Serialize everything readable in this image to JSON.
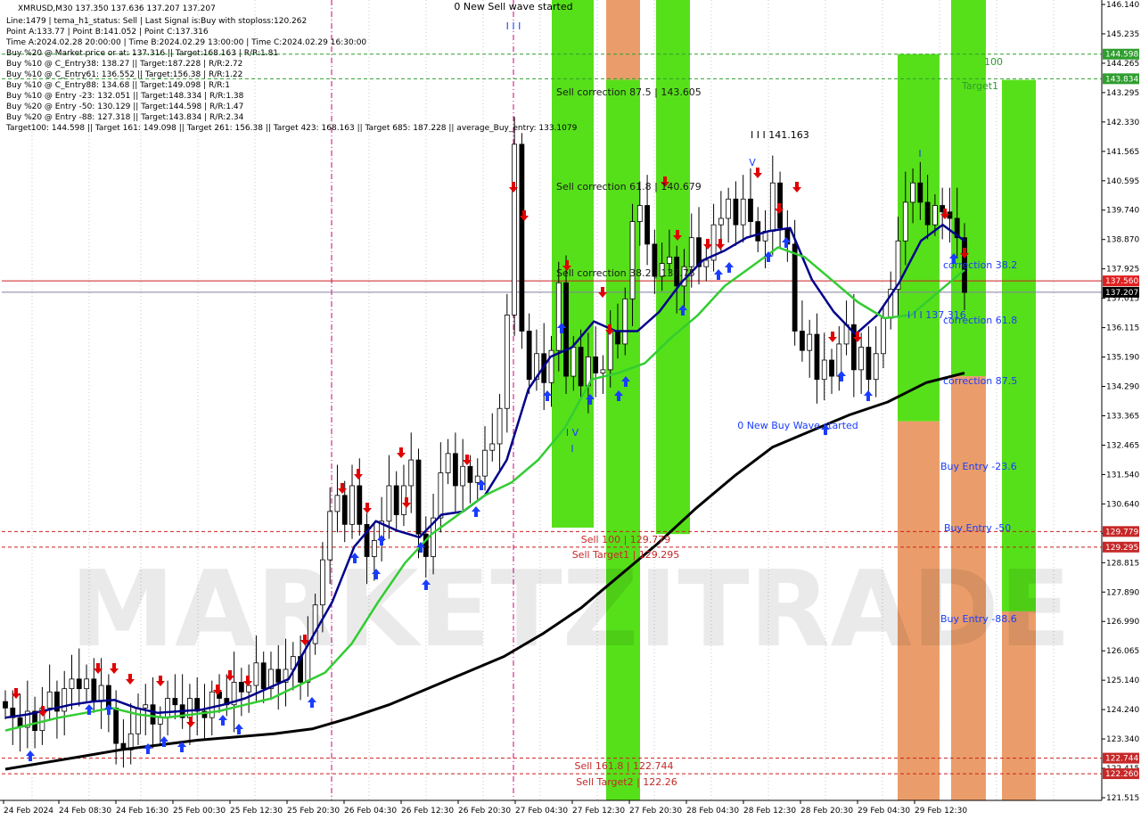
{
  "header": {
    "symbol_line": "XMRUSD,M30  137.350 137.636 137.207 137.207",
    "lines": [
      "Line:1479 | tema_h1_status: Sell | Last Signal is:Buy with stoploss:120.262",
      "Point A:133.77 | Point B:141.052 | Point C:137.316",
      "Time A:2024.02.28 20:00:00 | Time B:2024.02.29 13:00:00 | Time C:2024.02.29 16:30:00",
      "Buy %20 @ Market price or at: 137.316 || Target:168.163 | R/R:1.81",
      "Buy %10 @ C_Entry38: 138.27 || Target:187.228 | R/R:2.72",
      "Buy %10 @ C_Entry61: 136.552 || Target:156.38 | R/R:1.22",
      "Buy %10 @ C_Entry88: 134.68 || Target:149.098 | R/R:1",
      "Buy %10 @ Entry -23: 132.051 || Target:148.334 | R/R:1.38",
      "Buy %20 @ Entry -50: 130.129 || Target:144.598 | R/R:1.47",
      "Buy %20 @ Entry -88: 127.318 || Target:143.834 | R/R:2.34",
      "Target100: 144.598 || Target 161: 149.098 || Target 261: 156.38 || Target 423: 168.163 || Target 685: 187.228 || average_Buy_entry: 133.1079"
    ]
  },
  "watermark": "MARKETZITRADE",
  "price_axis": {
    "ticks": [
      "146.140",
      "145.235",
      "144.265",
      "143.295",
      "142.330",
      "141.565",
      "140.595",
      "139.740",
      "138.870",
      "137.925",
      "137.015",
      "136.115",
      "135.190",
      "134.290",
      "133.365",
      "132.465",
      "131.540",
      "130.640",
      "129.715",
      "128.815",
      "127.890",
      "126.990",
      "126.065",
      "125.140",
      "124.240",
      "123.340",
      "122.415",
      "121.515"
    ],
    "badges": [
      {
        "label": "144.598",
        "price": 144.598,
        "color": "#2e9e2e"
      },
      {
        "label": "143.834",
        "price": 143.834,
        "color": "#2e9e2e"
      },
      {
        "label": "137.560",
        "price": 137.56,
        "color": "#e02020"
      },
      {
        "label": "137.207",
        "price": 137.207,
        "color": "#000000"
      },
      {
        "label": "129.779",
        "price": 129.779,
        "color": "#c62828"
      },
      {
        "label": "129.295",
        "price": 129.295,
        "color": "#c62828"
      },
      {
        "label": "122.744",
        "price": 122.744,
        "color": "#c62828"
      },
      {
        "label": "122.260",
        "price": 122.26,
        "color": "#c62828"
      }
    ]
  },
  "time_axis": {
    "labels": [
      "24 Feb 2024",
      "24 Feb 08:30",
      "24 Feb 16:30",
      "25 Feb 00:30",
      "25 Feb 12:30",
      "25 Feb 20:30",
      "26 Feb 04:30",
      "26 Feb 12:30",
      "26 Feb 20:30",
      "27 Feb 04:30",
      "27 Feb 12:30",
      "27 Feb 20:30",
      "28 Feb 04:30",
      "28 Feb 12:30",
      "28 Feb 20:30",
      "29 Feb 04:30",
      "29 Feb 12:30"
    ]
  },
  "annotations": {
    "new_sell_wave": "0 New Sell wave started",
    "sell_wave_marker": "I I I",
    "sell_corr_875": "Sell correction 87.5 | 143.605",
    "sell_corr_618": "Sell correction 61.8 | 140.679",
    "sell_corr_382": "Sell correction 38.2 | 137.75",
    "sell_100": "Sell 100 | 129.779",
    "sell_target1": "Sell Target1 | 129.295",
    "sell_1618": "Sell 161.8 | 122.744",
    "sell_target2": "Sell Target2 | 122.26",
    "high_label": "I I I 141.163",
    "v_marker": "V",
    "iv_marker": "I V",
    "i_marker": "I",
    "new_buy_wave": "0 New Buy Wave started",
    "c_label": "I I I 137.316",
    "corr_382": "correction 38.2",
    "corr_618": "correction 61.8",
    "corr_875": "correction 87.5",
    "buy_entry_23": "Buy Entry -23.6",
    "buy_entry_50": "Buy Entry -50",
    "buy_entry_88": "Buy Entry -88.6",
    "target_100": "100",
    "target_1": "Target1"
  },
  "colors": {
    "green_zone": "#44dd00",
    "orange_zone": "#e8925a",
    "fast_ma": "#00008b",
    "mid_ma": "#33cc33",
    "slow_ma": "#000000",
    "sell_arrow": "#e00000",
    "buy_arrow": "#1a3cff",
    "level_red": "#c62828"
  },
  "chart_data": {
    "type": "candlestick",
    "symbol": "XMRUSD",
    "timeframe": "M30",
    "ylim": [
      121.1,
      146.3
    ],
    "levels": [
      {
        "price": 144.598,
        "style": "dashed",
        "color": "green"
      },
      {
        "price": 143.834,
        "style": "dashed",
        "color": "green"
      },
      {
        "price": 137.56,
        "style": "solid",
        "color": "red"
      },
      {
        "price": 137.207,
        "style": "solid",
        "color": "gray"
      },
      {
        "price": 129.779,
        "style": "dashed",
        "color": "red"
      },
      {
        "price": 129.295,
        "style": "dashed",
        "color": "red"
      },
      {
        "price": 122.744,
        "style": "dashed",
        "color": "red"
      },
      {
        "price": 122.26,
        "style": "dashed",
        "color": "red"
      }
    ],
    "price_path": [
      124.3,
      124.0,
      123.7,
      124.2,
      123.6,
      124.3,
      124.8,
      124.2,
      124.9,
      125.2,
      124.9,
      125.2,
      124.5,
      125.0,
      124.3,
      123.2,
      123.0,
      123.5,
      124.3,
      124.4,
      123.8,
      124.0,
      124.6,
      124.4,
      124.0,
      124.6,
      124.2,
      124.0,
      124.8,
      124.6,
      124.4,
      125.1,
      124.8,
      125.0,
      125.7,
      124.9,
      125.5,
      125.1,
      125.5,
      125.9,
      125.1,
      126.3,
      127.5,
      128.9,
      130.4,
      130.9,
      130.0,
      131.2,
      130.0,
      129.0,
      129.5,
      130.1,
      131.2,
      130.3,
      131.2,
      132.0,
      129.7,
      129.0,
      130.2,
      131.6,
      132.2,
      131.2,
      131.8,
      131.3,
      131.5,
      132.3,
      132.5,
      133.6,
      136.5,
      141.8,
      136.0,
      134.5,
      135.3,
      134.4,
      135.4,
      137.5,
      134.6,
      135.5,
      134.3,
      135.2,
      134.7,
      134.8,
      136.0,
      135.6,
      137.0,
      139.4,
      139.9,
      138.7,
      137.7,
      138.1,
      138.3,
      137.4,
      138.0,
      138.9,
      138.0,
      138.2,
      139.3,
      139.5,
      140.1,
      139.3,
      140.1,
      139.4,
      138.8,
      139.1,
      140.6,
      139.2,
      138.7,
      136.0,
      135.4,
      135.9,
      134.5,
      135.1,
      134.6,
      135.6,
      136.2,
      134.8,
      135.5,
      134.5,
      135.3,
      136.4,
      137.3,
      138.8,
      140.0,
      140.6,
      140.0,
      139.3,
      139.9,
      139.7,
      139.5,
      138.9,
      137.2
    ],
    "moving_averages": [
      {
        "name": "fast",
        "color": "#00008b",
        "values": [
          124.0,
          124.1,
          124.25,
          124.4,
          124.5,
          124.55,
          124.3,
          124.15,
          124.2,
          124.25,
          124.4,
          124.6,
          124.9,
          125.2,
          126.4,
          127.6,
          129.3,
          130.1,
          129.8,
          129.6,
          130.3,
          130.4,
          130.9,
          132.0,
          134.2,
          135.2,
          135.5,
          136.3,
          136.0,
          136.0,
          136.6,
          137.5,
          138.2,
          138.5,
          138.9,
          139.1,
          139.2,
          137.6,
          136.6,
          135.9,
          136.5,
          137.5,
          138.8,
          139.3,
          138.8
        ]
      },
      {
        "name": "mid",
        "color": "#33cc33",
        "values": [
          123.6,
          123.8,
          124.0,
          124.15,
          124.3,
          124.1,
          124.0,
          124.1,
          124.2,
          124.4,
          124.6,
          125.0,
          125.4,
          126.3,
          127.6,
          128.8,
          129.7,
          130.3,
          130.9,
          131.3,
          132.0,
          133.0,
          134.5,
          134.7,
          135.0,
          135.8,
          136.5,
          137.4,
          138.0,
          138.6,
          138.3,
          137.6,
          136.9,
          136.4,
          136.5,
          137.2,
          137.9
        ]
      },
      {
        "name": "slow",
        "color": "#000000",
        "values": [
          122.4,
          122.6,
          122.8,
          123.0,
          123.15,
          123.3,
          123.4,
          123.5,
          123.65,
          124.0,
          124.4,
          124.9,
          125.4,
          125.9,
          126.6,
          127.4,
          128.4,
          129.4,
          130.5,
          131.5,
          132.4,
          132.9,
          133.4,
          133.8,
          134.4,
          134.7
        ]
      }
    ],
    "zones": [
      {
        "label": "sell green zone 1",
        "from": 146.3,
        "to": 129.9,
        "color": "green"
      },
      {
        "label": "sell orange zone",
        "from": 146.3,
        "to": 143.8,
        "color": "orange"
      },
      {
        "label": "sell green zone 2",
        "from": 146.3,
        "to": 129.7,
        "color": "green"
      },
      {
        "label": "buy green zone 1",
        "from": 144.6,
        "to": 133.2,
        "color": "green"
      },
      {
        "label": "buy orange zone 1",
        "from": 133.2,
        "to": 121.1,
        "color": "orange"
      },
      {
        "label": "buy green zone 2",
        "from": 146.3,
        "to": 134.6,
        "color": "green"
      },
      {
        "label": "buy orange zone 2",
        "from": 134.6,
        "to": 121.1,
        "color": "orange"
      },
      {
        "label": "buy green zone 3",
        "from": 143.8,
        "to": 127.3,
        "color": "green"
      },
      {
        "label": "buy orange zone 3",
        "from": 127.3,
        "to": 121.1,
        "color": "orange"
      }
    ]
  }
}
